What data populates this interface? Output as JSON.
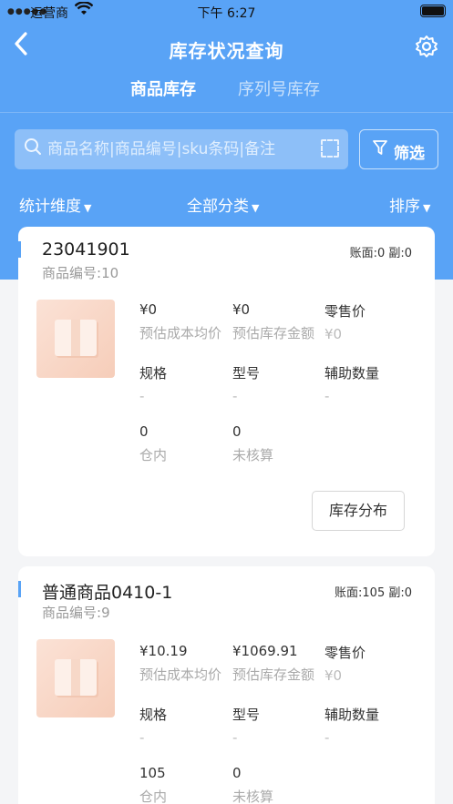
{
  "status_bar": {
    "carrier": "运营商",
    "time": "下午 6:27"
  },
  "nav": {
    "title": "库存状况查询"
  },
  "tabs": [
    {
      "label": "商品库存",
      "active": true
    },
    {
      "label": "序列号库存",
      "active": false
    }
  ],
  "search": {
    "placeholder": "商品名称|商品编号|sku条码|备注"
  },
  "filter": {
    "label": "筛选"
  },
  "dimensions": {
    "stat": "统计维度",
    "category": "全部分类",
    "sort": "排序"
  },
  "products": [
    {
      "name": "23041901",
      "code_label": "商品编号:",
      "code": "10",
      "stock_text": "账面:0 副:0",
      "avg_cost": "¥0",
      "avg_cost_label": "预估成本均价",
      "stock_amount": "¥0",
      "stock_amount_label": "预估库存金额",
      "retail_label": "零售价",
      "retail": "¥0",
      "spec_label": "规格",
      "spec": "-",
      "model_label": "型号",
      "model": "-",
      "aux_label": "辅助数量",
      "aux": "-",
      "in_wh": "0",
      "in_wh_label": "仓内",
      "unaccounted": "0",
      "unaccounted_label": "未核算",
      "dist_button": "库存分布"
    },
    {
      "name": "普通商品0410-1",
      "code_label": "商品编号:",
      "code": "9",
      "stock_text": "账面:105 副:0",
      "avg_cost": "¥10.19",
      "avg_cost_label": "预估成本均价",
      "stock_amount": "¥1069.91",
      "stock_amount_label": "预估库存金额",
      "retail_label": "零售价",
      "retail": "¥0",
      "spec_label": "规格",
      "spec": "-",
      "model_label": "型号",
      "model": "-",
      "aux_label": "辅助数量",
      "aux": "-",
      "in_wh": "105",
      "in_wh_label": "仓内",
      "unaccounted": "0",
      "unaccounted_label": "未核算"
    }
  ],
  "colors": {
    "primary": "#59a3f6",
    "background": "#f4f5f7"
  }
}
